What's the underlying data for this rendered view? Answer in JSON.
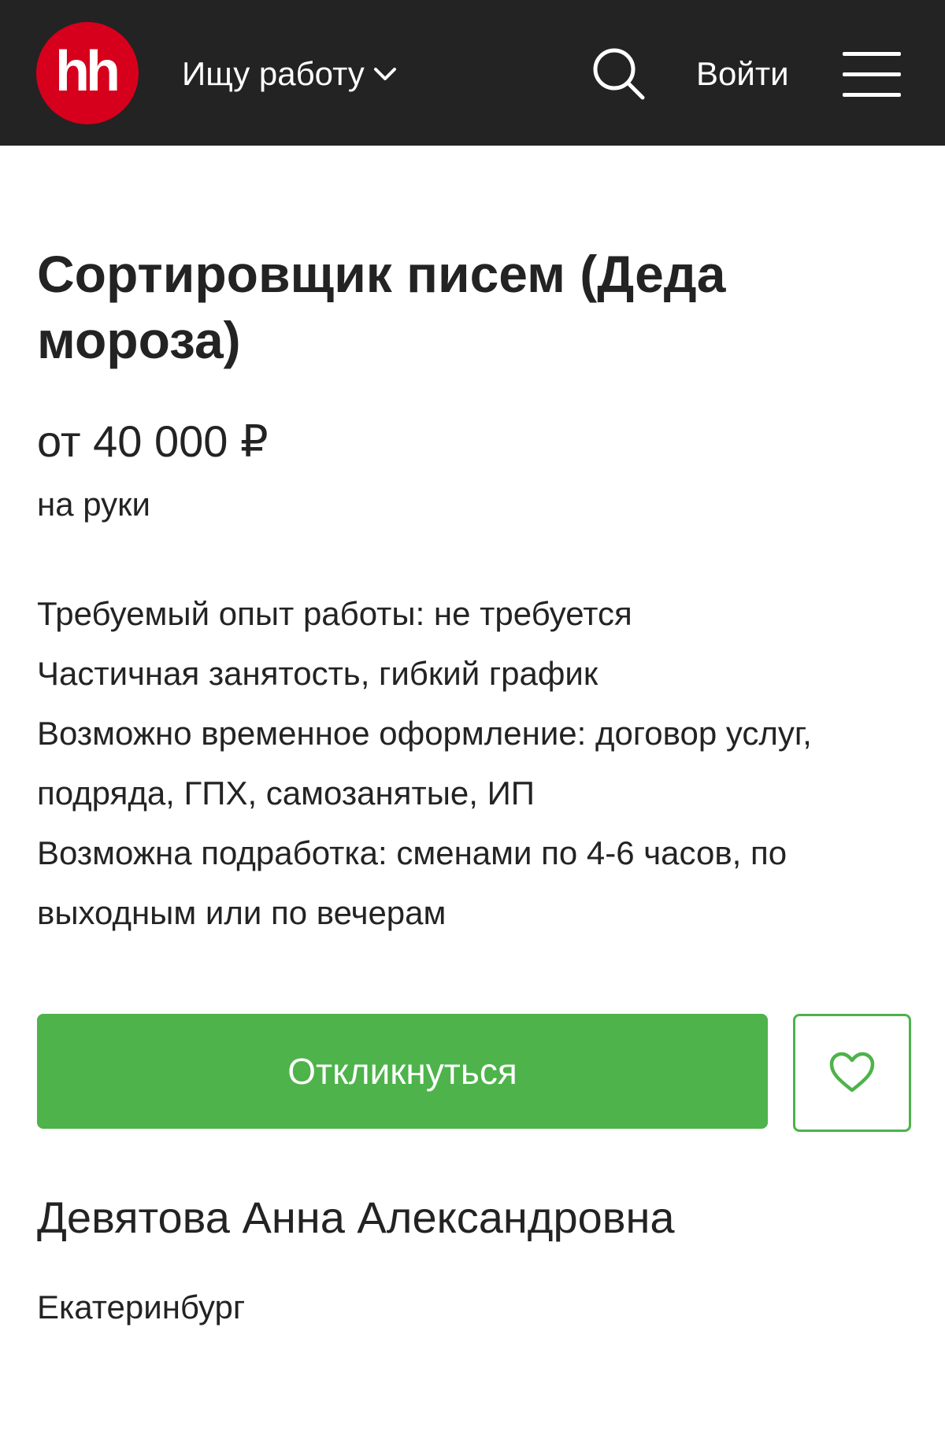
{
  "header": {
    "logo_text": "hh",
    "role_dropdown_label": "Ищу работу",
    "login_label": "Войти",
    "icons": {
      "search": "search-icon",
      "menu": "hamburger-menu-icon",
      "dropdown": "chevron-down-icon"
    }
  },
  "vacancy": {
    "title": "Сортировщик писем (Деда мороза)",
    "salary": "от 40 000 ₽",
    "salary_note": "на руки",
    "details": [
      "Требуемый опыт работы: не требуется",
      "Частичная занятость, гибкий график",
      "Возможно временное оформление: договор услуг, подряда, ГПХ, самозанятые, ИП",
      "Возможна подработка: сменами по 4-6 часов, по выходным или по вечерам"
    ]
  },
  "actions": {
    "apply_label": "Откликнуться",
    "favorite_icon": "heart-icon"
  },
  "employer": {
    "name": "Девятова Анна Александровна",
    "city": "Екатеринбург"
  },
  "colors": {
    "header_bg": "#232323",
    "logo_red": "#d6001c",
    "accent_green": "#4db34a",
    "text": "#232323"
  }
}
